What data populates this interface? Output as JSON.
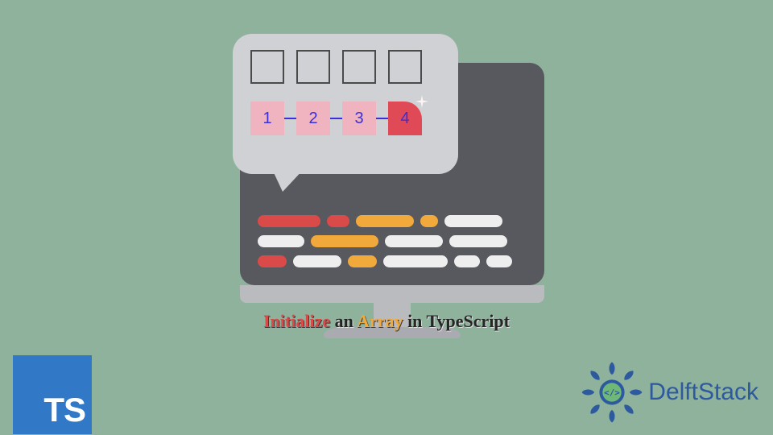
{
  "caption": {
    "initialize": "Initialize",
    "an": "an",
    "array": "Array",
    "rest": "in TypeScript"
  },
  "bubble": {
    "numbers": [
      "1",
      "2",
      "3",
      "4"
    ]
  },
  "ts_badge": "TS",
  "brand": "DelftStack",
  "colors": {
    "bg": "#8fb29d",
    "red": "#d94a49",
    "orange": "#f2a93b",
    "ts_blue": "#3178c6",
    "brand_blue": "#2d5a9e"
  }
}
